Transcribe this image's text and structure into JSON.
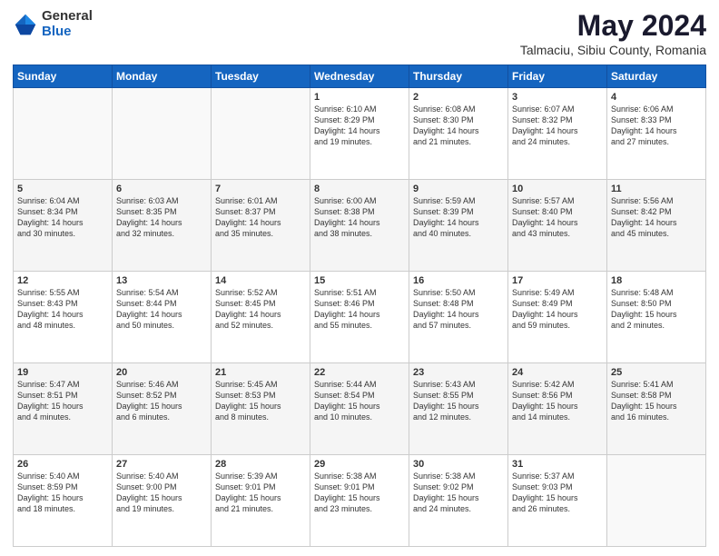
{
  "header": {
    "logo_general": "General",
    "logo_blue": "Blue",
    "month_title": "May 2024",
    "location": "Talmaciu, Sibiu County, Romania"
  },
  "days_of_week": [
    "Sunday",
    "Monday",
    "Tuesday",
    "Wednesday",
    "Thursday",
    "Friday",
    "Saturday"
  ],
  "weeks": [
    [
      {
        "day": "",
        "info": ""
      },
      {
        "day": "",
        "info": ""
      },
      {
        "day": "",
        "info": ""
      },
      {
        "day": "1",
        "info": "Sunrise: 6:10 AM\nSunset: 8:29 PM\nDaylight: 14 hours\nand 19 minutes."
      },
      {
        "day": "2",
        "info": "Sunrise: 6:08 AM\nSunset: 8:30 PM\nDaylight: 14 hours\nand 21 minutes."
      },
      {
        "day": "3",
        "info": "Sunrise: 6:07 AM\nSunset: 8:32 PM\nDaylight: 14 hours\nand 24 minutes."
      },
      {
        "day": "4",
        "info": "Sunrise: 6:06 AM\nSunset: 8:33 PM\nDaylight: 14 hours\nand 27 minutes."
      }
    ],
    [
      {
        "day": "5",
        "info": "Sunrise: 6:04 AM\nSunset: 8:34 PM\nDaylight: 14 hours\nand 30 minutes."
      },
      {
        "day": "6",
        "info": "Sunrise: 6:03 AM\nSunset: 8:35 PM\nDaylight: 14 hours\nand 32 minutes."
      },
      {
        "day": "7",
        "info": "Sunrise: 6:01 AM\nSunset: 8:37 PM\nDaylight: 14 hours\nand 35 minutes."
      },
      {
        "day": "8",
        "info": "Sunrise: 6:00 AM\nSunset: 8:38 PM\nDaylight: 14 hours\nand 38 minutes."
      },
      {
        "day": "9",
        "info": "Sunrise: 5:59 AM\nSunset: 8:39 PM\nDaylight: 14 hours\nand 40 minutes."
      },
      {
        "day": "10",
        "info": "Sunrise: 5:57 AM\nSunset: 8:40 PM\nDaylight: 14 hours\nand 43 minutes."
      },
      {
        "day": "11",
        "info": "Sunrise: 5:56 AM\nSunset: 8:42 PM\nDaylight: 14 hours\nand 45 minutes."
      }
    ],
    [
      {
        "day": "12",
        "info": "Sunrise: 5:55 AM\nSunset: 8:43 PM\nDaylight: 14 hours\nand 48 minutes."
      },
      {
        "day": "13",
        "info": "Sunrise: 5:54 AM\nSunset: 8:44 PM\nDaylight: 14 hours\nand 50 minutes."
      },
      {
        "day": "14",
        "info": "Sunrise: 5:52 AM\nSunset: 8:45 PM\nDaylight: 14 hours\nand 52 minutes."
      },
      {
        "day": "15",
        "info": "Sunrise: 5:51 AM\nSunset: 8:46 PM\nDaylight: 14 hours\nand 55 minutes."
      },
      {
        "day": "16",
        "info": "Sunrise: 5:50 AM\nSunset: 8:48 PM\nDaylight: 14 hours\nand 57 minutes."
      },
      {
        "day": "17",
        "info": "Sunrise: 5:49 AM\nSunset: 8:49 PM\nDaylight: 14 hours\nand 59 minutes."
      },
      {
        "day": "18",
        "info": "Sunrise: 5:48 AM\nSunset: 8:50 PM\nDaylight: 15 hours\nand 2 minutes."
      }
    ],
    [
      {
        "day": "19",
        "info": "Sunrise: 5:47 AM\nSunset: 8:51 PM\nDaylight: 15 hours\nand 4 minutes."
      },
      {
        "day": "20",
        "info": "Sunrise: 5:46 AM\nSunset: 8:52 PM\nDaylight: 15 hours\nand 6 minutes."
      },
      {
        "day": "21",
        "info": "Sunrise: 5:45 AM\nSunset: 8:53 PM\nDaylight: 15 hours\nand 8 minutes."
      },
      {
        "day": "22",
        "info": "Sunrise: 5:44 AM\nSunset: 8:54 PM\nDaylight: 15 hours\nand 10 minutes."
      },
      {
        "day": "23",
        "info": "Sunrise: 5:43 AM\nSunset: 8:55 PM\nDaylight: 15 hours\nand 12 minutes."
      },
      {
        "day": "24",
        "info": "Sunrise: 5:42 AM\nSunset: 8:56 PM\nDaylight: 15 hours\nand 14 minutes."
      },
      {
        "day": "25",
        "info": "Sunrise: 5:41 AM\nSunset: 8:58 PM\nDaylight: 15 hours\nand 16 minutes."
      }
    ],
    [
      {
        "day": "26",
        "info": "Sunrise: 5:40 AM\nSunset: 8:59 PM\nDaylight: 15 hours\nand 18 minutes."
      },
      {
        "day": "27",
        "info": "Sunrise: 5:40 AM\nSunset: 9:00 PM\nDaylight: 15 hours\nand 19 minutes."
      },
      {
        "day": "28",
        "info": "Sunrise: 5:39 AM\nSunset: 9:01 PM\nDaylight: 15 hours\nand 21 minutes."
      },
      {
        "day": "29",
        "info": "Sunrise: 5:38 AM\nSunset: 9:01 PM\nDaylight: 15 hours\nand 23 minutes."
      },
      {
        "day": "30",
        "info": "Sunrise: 5:38 AM\nSunset: 9:02 PM\nDaylight: 15 hours\nand 24 minutes."
      },
      {
        "day": "31",
        "info": "Sunrise: 5:37 AM\nSunset: 9:03 PM\nDaylight: 15 hours\nand 26 minutes."
      },
      {
        "day": "",
        "info": ""
      }
    ]
  ]
}
